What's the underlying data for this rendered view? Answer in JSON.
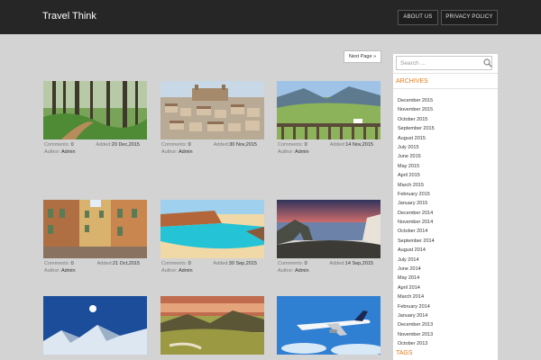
{
  "header": {
    "title": "Travel Think",
    "nav": [
      "ABOUT US",
      "PRIVACY POLICY"
    ]
  },
  "pagination": {
    "next_label": "Next Page »"
  },
  "posts": [
    {
      "comments_label": "Comments:",
      "comments": "0",
      "added_label": "Added:",
      "added": "20 Dec,2015",
      "author_label": "Author:",
      "author": "Admin"
    },
    {
      "comments_label": "Comments:",
      "comments": "0",
      "added_label": "Added:",
      "added": "30 Nov,2015",
      "author_label": "Author:",
      "author": "Admin"
    },
    {
      "comments_label": "Comments:",
      "comments": "0",
      "added_label": "Added:",
      "added": "14 Nov,2015",
      "author_label": "Author:",
      "author": "Admin"
    },
    {
      "comments_label": "Comments:",
      "comments": "0",
      "added_label": "Added:",
      "added": "21 Oct,2015",
      "author_label": "Author:",
      "author": "Admin"
    },
    {
      "comments_label": "Comments:",
      "comments": "0",
      "added_label": "Added:",
      "added": "30 Sep,2015",
      "author_label": "Author:",
      "author": "Admin"
    },
    {
      "comments_label": "Comments:",
      "comments": "0",
      "added_label": "Added:",
      "added": "14 Sep,2015",
      "author_label": "Author:",
      "author": "Admin"
    }
  ],
  "sidebar": {
    "search_placeholder": "Search ...",
    "archives_title": "ARCHIVES",
    "archives": [
      "December 2015",
      "November 2015",
      "October 2015",
      "September 2015",
      "August 2015",
      "July 2015",
      "June 2015",
      "May 2015",
      "April 2015",
      "March 2015",
      "February 2015",
      "January 2015",
      "December 2014",
      "November 2014",
      "October 2014",
      "September 2014",
      "August 2014",
      "July 2014",
      "June 2014",
      "May 2014",
      "April 2014",
      "March 2014",
      "February 2014",
      "January 2014",
      "December 2013",
      "November 2013",
      "October 2013"
    ],
    "tags_title": "TAGS"
  },
  "colors": {
    "topbar": "#262626",
    "accent": "#e07b1f",
    "page_bg": "#d3d3d3"
  }
}
